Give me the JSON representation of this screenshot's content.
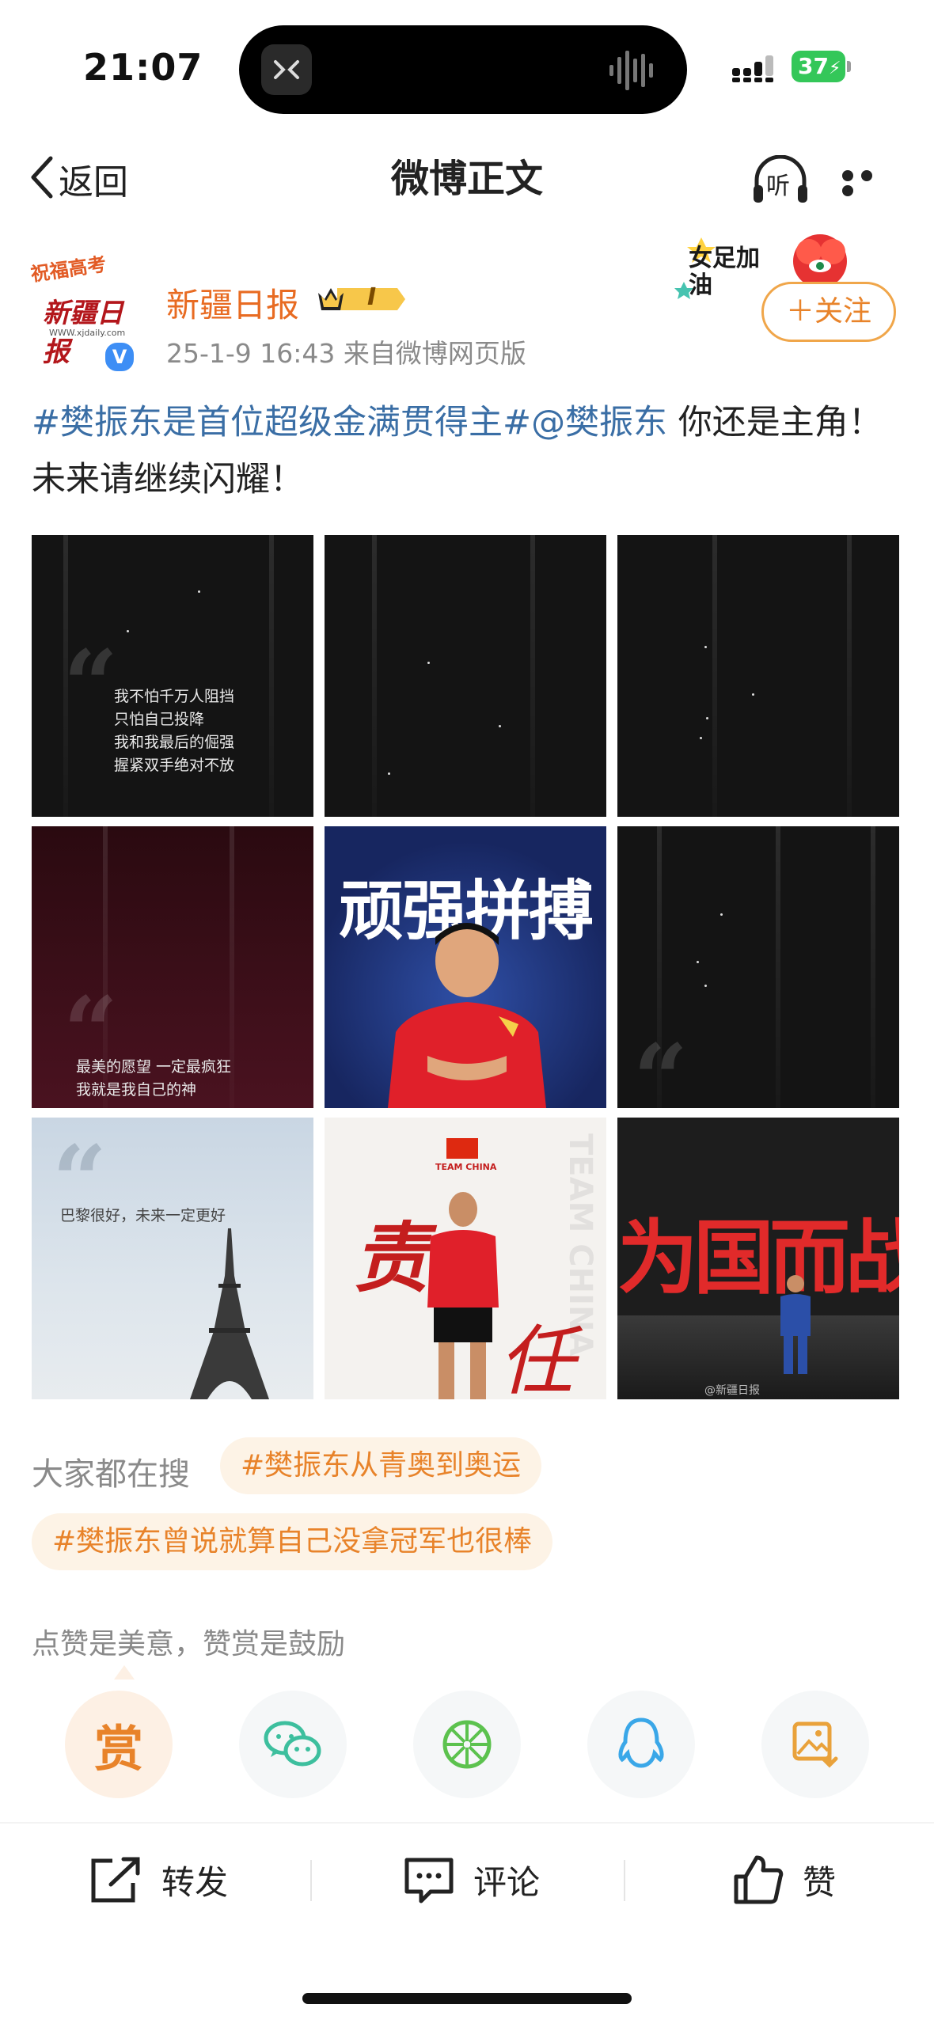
{
  "status_bar": {
    "time": "21:07",
    "battery": "37"
  },
  "nav": {
    "back_label": "返回",
    "title": "微博正文",
    "listen_label": "听"
  },
  "author": {
    "name": "新疆日报",
    "member_level": "I",
    "avatar_badge": "祝福高考",
    "avatar_logo": "新疆日报",
    "avatar_url": "WWW.xjdaily.com",
    "verified_mark": "V",
    "meta": "25-1-9 16:43  来自微博网页版",
    "sticker_text": "女足加油",
    "follow_label": "＋关注"
  },
  "post": {
    "hashtag": "#樊振东是首位超级金满贯得主#",
    "mention": "@樊振东",
    "text": " 你还是主角！ 未来请继续闪耀！"
  },
  "images": {
    "img1_lines": [
      "我不怕千万人阻挡",
      "只怕自己投降",
      "我和我最后的倔强",
      "握紧双手绝对不放"
    ],
    "img4_lines": [
      "最美的愿望 一定最疯狂",
      "我就是我自己的神"
    ],
    "img5_title": "顽强拼搏",
    "img7_line": "巴黎很好，未来一定更好",
    "img8_team": "TEAM CHINA",
    "img8_char1": "责",
    "img8_char2": "任",
    "img8_side": "TEAM CHINA",
    "img9_title": "为国而战",
    "img9_watermark": "@新疆日报"
  },
  "search": {
    "label": "大家都在搜",
    "chips": [
      "#樊振东从青奥到奥运",
      "#樊振东曾说就算自己没拿冠军也很棒"
    ]
  },
  "like_hint": "点赞是美意，赞赏是鼓励",
  "share": {
    "reward_label": "赏",
    "icons": [
      "wechat-icon",
      "moments-icon",
      "qq-icon",
      "save-image-icon"
    ]
  },
  "actions": {
    "repost": "转发",
    "comment": "评论",
    "like": "赞"
  },
  "colors": {
    "accent": "#e8832a",
    "link": "#3a6ea5",
    "verified": "#3d8ef5",
    "battery": "#34c759"
  }
}
